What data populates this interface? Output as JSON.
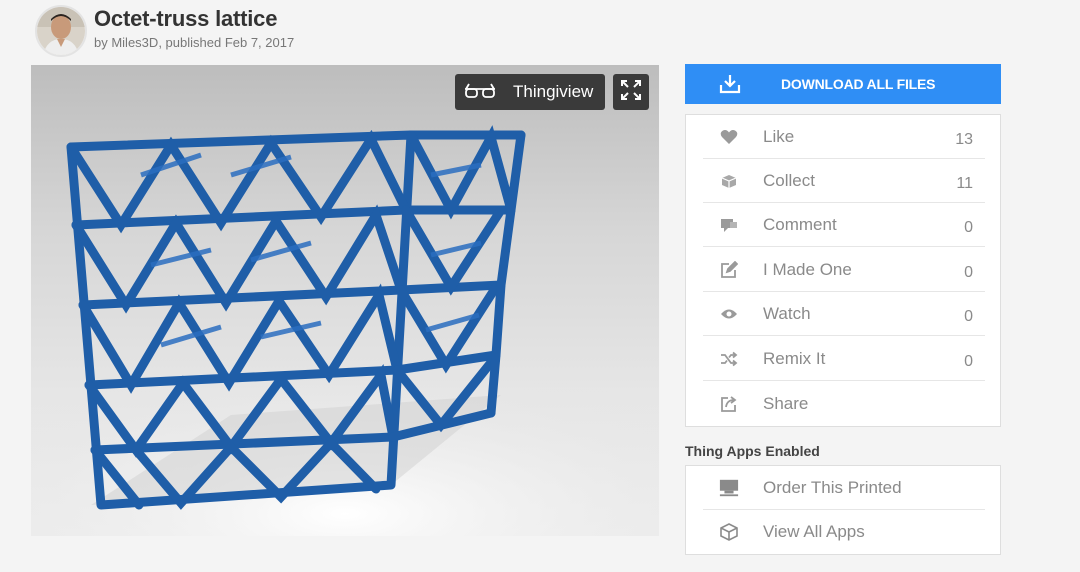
{
  "thing": {
    "title": "Octet-truss lattice",
    "by_prefix": "by ",
    "author": "Miles3D",
    "published_text": ", published ",
    "date": "Feb 7, 2017"
  },
  "viewer": {
    "thingiview_label": "Thingiview"
  },
  "download": {
    "label": "DOWNLOAD ALL FILES"
  },
  "actions": [
    {
      "label": "Like",
      "count": "13",
      "icon": "heart-icon"
    },
    {
      "label": "Collect",
      "count": "11",
      "icon": "collect-icon"
    },
    {
      "label": "Comment",
      "count": "0",
      "icon": "comment-icon"
    },
    {
      "label": "I Made One",
      "count": "0",
      "icon": "edit-icon"
    },
    {
      "label": "Watch",
      "count": "0",
      "icon": "eye-icon"
    },
    {
      "label": "Remix It",
      "count": "0",
      "icon": "shuffle-icon"
    },
    {
      "label": "Share",
      "count": "",
      "icon": "share-icon"
    }
  ],
  "apps": {
    "heading": "Thing Apps Enabled",
    "items": [
      {
        "label": "Order This Printed",
        "icon": "printer-icon"
      },
      {
        "label": "View All Apps",
        "icon": "cube-icon"
      }
    ]
  },
  "colors": {
    "accent": "#2f8ef5",
    "lattice": "#1f5ea8",
    "icon_gray": "#9a9a9a"
  }
}
